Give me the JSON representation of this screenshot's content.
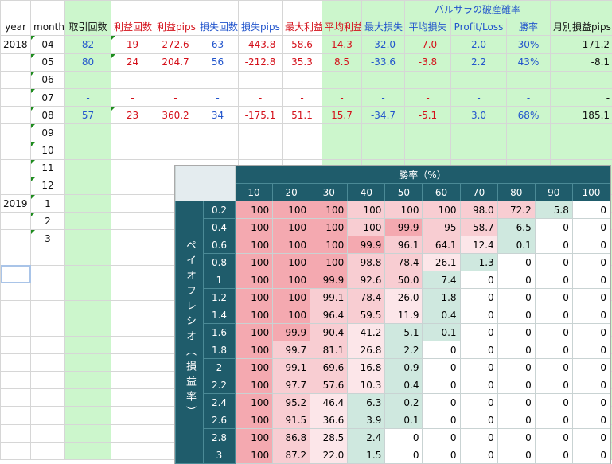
{
  "sheet": {
    "title_ruin": "バルサラの破産確率",
    "headers": [
      "year",
      "month",
      "取引回数",
      "利益回数",
      "利益pips",
      "損失回数",
      "損失pips",
      "最大利益",
      "平均利益",
      "最大損失",
      "平均損失",
      "Profit/Loss",
      "勝率",
      "月別損益pips"
    ],
    "rows": [
      {
        "year": "2018",
        "month": "04",
        "trades": "82",
        "wins": "19",
        "win_pips": "272.6",
        "losses": "63",
        "loss_pips": "-443.8",
        "max_win": "58.6",
        "avg_win": "14.3",
        "max_loss": "-32.0",
        "avg_loss": "-7.0",
        "pl": "2.0",
        "winrate": "30%",
        "monthly": "-171.2"
      },
      {
        "year": "",
        "month": "05",
        "trades": "80",
        "wins": "24",
        "win_pips": "204.7",
        "losses": "56",
        "loss_pips": "-212.8",
        "max_win": "35.3",
        "avg_win": "8.5",
        "max_loss": "-33.6",
        "avg_loss": "-3.8",
        "pl": "2.2",
        "winrate": "43%",
        "monthly": "-8.1"
      },
      {
        "year": "",
        "month": "06",
        "trades": "-",
        "wins": "-",
        "win_pips": "-",
        "losses": "-",
        "loss_pips": "-",
        "max_win": "-",
        "avg_win": "-",
        "max_loss": "-",
        "avg_loss": "-",
        "pl": "-",
        "winrate": "-",
        "monthly": "-"
      },
      {
        "year": "",
        "month": "07",
        "trades": "-",
        "wins": "-",
        "win_pips": "-",
        "losses": "-",
        "loss_pips": "-",
        "max_win": "-",
        "avg_win": "-",
        "max_loss": "-",
        "avg_loss": "-",
        "pl": "-",
        "winrate": "-",
        "monthly": "-"
      },
      {
        "year": "",
        "month": "08",
        "trades": "57",
        "wins": "23",
        "win_pips": "360.2",
        "losses": "34",
        "loss_pips": "-175.1",
        "max_win": "51.1",
        "avg_win": "15.7",
        "max_loss": "-34.7",
        "avg_loss": "-5.1",
        "pl": "3.0",
        "winrate": "68%",
        "monthly": "185.1"
      },
      {
        "year": "",
        "month": "09"
      },
      {
        "year": "",
        "month": "10"
      },
      {
        "year": "",
        "month": "11"
      },
      {
        "year": "",
        "month": "12"
      },
      {
        "year": "2019",
        "month": "1"
      },
      {
        "year": "",
        "month": "2"
      },
      {
        "year": "",
        "month": "3"
      }
    ]
  },
  "ruin_table": {
    "title": "勝率（%）",
    "side_label": "ペイオフレシオ（損益率）",
    "win_rates": [
      "10",
      "20",
      "30",
      "40",
      "50",
      "60",
      "70",
      "80",
      "90",
      "100"
    ],
    "payoff_ratios": [
      "0.2",
      "0.4",
      "0.6",
      "0.8",
      "1",
      "1.2",
      "1.4",
      "1.6",
      "1.8",
      "2",
      "2.2",
      "2.4",
      "2.6",
      "2.8",
      "3"
    ],
    "values": [
      [
        "100",
        "100",
        "100",
        "100",
        "100",
        "100",
        "98.0",
        "72.2",
        "5.8",
        "0"
      ],
      [
        "100",
        "100",
        "100",
        "100",
        "99.9",
        "95",
        "58.7",
        "6.5",
        "0",
        "0"
      ],
      [
        "100",
        "100",
        "100",
        "99.9",
        "96.1",
        "64.1",
        "12.4",
        "0.1",
        "0",
        "0"
      ],
      [
        "100",
        "100",
        "100",
        "98.8",
        "78.4",
        "26.1",
        "1.3",
        "0",
        "0",
        "0"
      ],
      [
        "100",
        "100",
        "99.9",
        "92.6",
        "50.0",
        "7.4",
        "0",
        "0",
        "0",
        "0"
      ],
      [
        "100",
        "100",
        "99.1",
        "78.4",
        "26.0",
        "1.8",
        "0",
        "0",
        "0",
        "0"
      ],
      [
        "100",
        "100",
        "96.4",
        "59.5",
        "11.9",
        "0.4",
        "0",
        "0",
        "0",
        "0"
      ],
      [
        "100",
        "99.9",
        "90.4",
        "41.2",
        "5.1",
        "0.1",
        "0",
        "0",
        "0",
        "0"
      ],
      [
        "100",
        "99.7",
        "81.1",
        "26.8",
        "2.2",
        "0",
        "0",
        "0",
        "0",
        "0"
      ],
      [
        "100",
        "99.1",
        "69.6",
        "16.8",
        "0.9",
        "0",
        "0",
        "0",
        "0",
        "0"
      ],
      [
        "100",
        "97.7",
        "57.6",
        "10.3",
        "0.4",
        "0",
        "0",
        "0",
        "0",
        "0"
      ],
      [
        "100",
        "95.2",
        "46.4",
        "6.3",
        "0.2",
        "0",
        "0",
        "0",
        "0",
        "0"
      ],
      [
        "100",
        "91.5",
        "36.6",
        "3.9",
        "0.1",
        "0",
        "0",
        "0",
        "0",
        "0"
      ],
      [
        "100",
        "86.8",
        "28.5",
        "2.4",
        "0",
        "0",
        "0",
        "0",
        "0",
        "0"
      ],
      [
        "100",
        "87.2",
        "22.0",
        "1.5",
        "0",
        "0",
        "0",
        "0",
        "0",
        "0"
      ]
    ],
    "colors": {
      "red": "#f4a9b0",
      "pink": "#f8cdd2",
      "light_pink": "#fce6e9",
      "green": "#cfe8df",
      "header": "#1f5c6b"
    }
  }
}
